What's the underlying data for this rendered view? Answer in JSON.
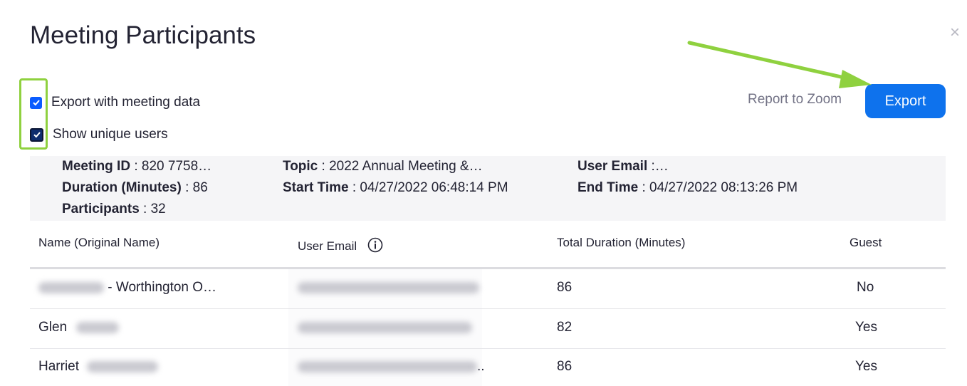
{
  "dialog": {
    "title": "Meeting Participants",
    "close_label": "×"
  },
  "options": {
    "export_with_meeting_data": "Export with meeting data",
    "show_unique_users": "Show unique users"
  },
  "actions": {
    "report_label": "Report to Zoom",
    "export_label": "Export"
  },
  "meeting_info": {
    "meeting_id_label": "Meeting ID",
    "meeting_id_value": " : 820 7758…",
    "duration_label": "Duration (Minutes)",
    "duration_value": " : 86",
    "participants_label": "Participants",
    "participants_value": " : 32",
    "topic_label": "Topic",
    "topic_value": " : 2022 Annual Meeting &…",
    "start_label": "Start Time",
    "start_value": " : 04/27/2022 06:48:14 PM",
    "user_email_label": "User Email",
    "user_email_value": " :…",
    "end_label": "End Time",
    "end_value": " : 04/27/2022 08:13:26 PM"
  },
  "table": {
    "headers": {
      "name": "Name (Original Name)",
      "email": "User Email",
      "duration": "Total Duration (Minutes)",
      "guest": "Guest"
    },
    "rows": [
      {
        "name": "- Worthington O…",
        "email_suffix": "",
        "duration": "86",
        "guest": "No"
      },
      {
        "name": "Glen",
        "email_suffix": "",
        "duration": "82",
        "guest": "Yes"
      },
      {
        "name": "Harriet",
        "email_suffix": "..",
        "duration": "86",
        "guest": "Yes"
      }
    ]
  },
  "colors": {
    "accent": "#0e72ed",
    "highlight": "#8fd13f",
    "arrow": "#8fd13f"
  }
}
